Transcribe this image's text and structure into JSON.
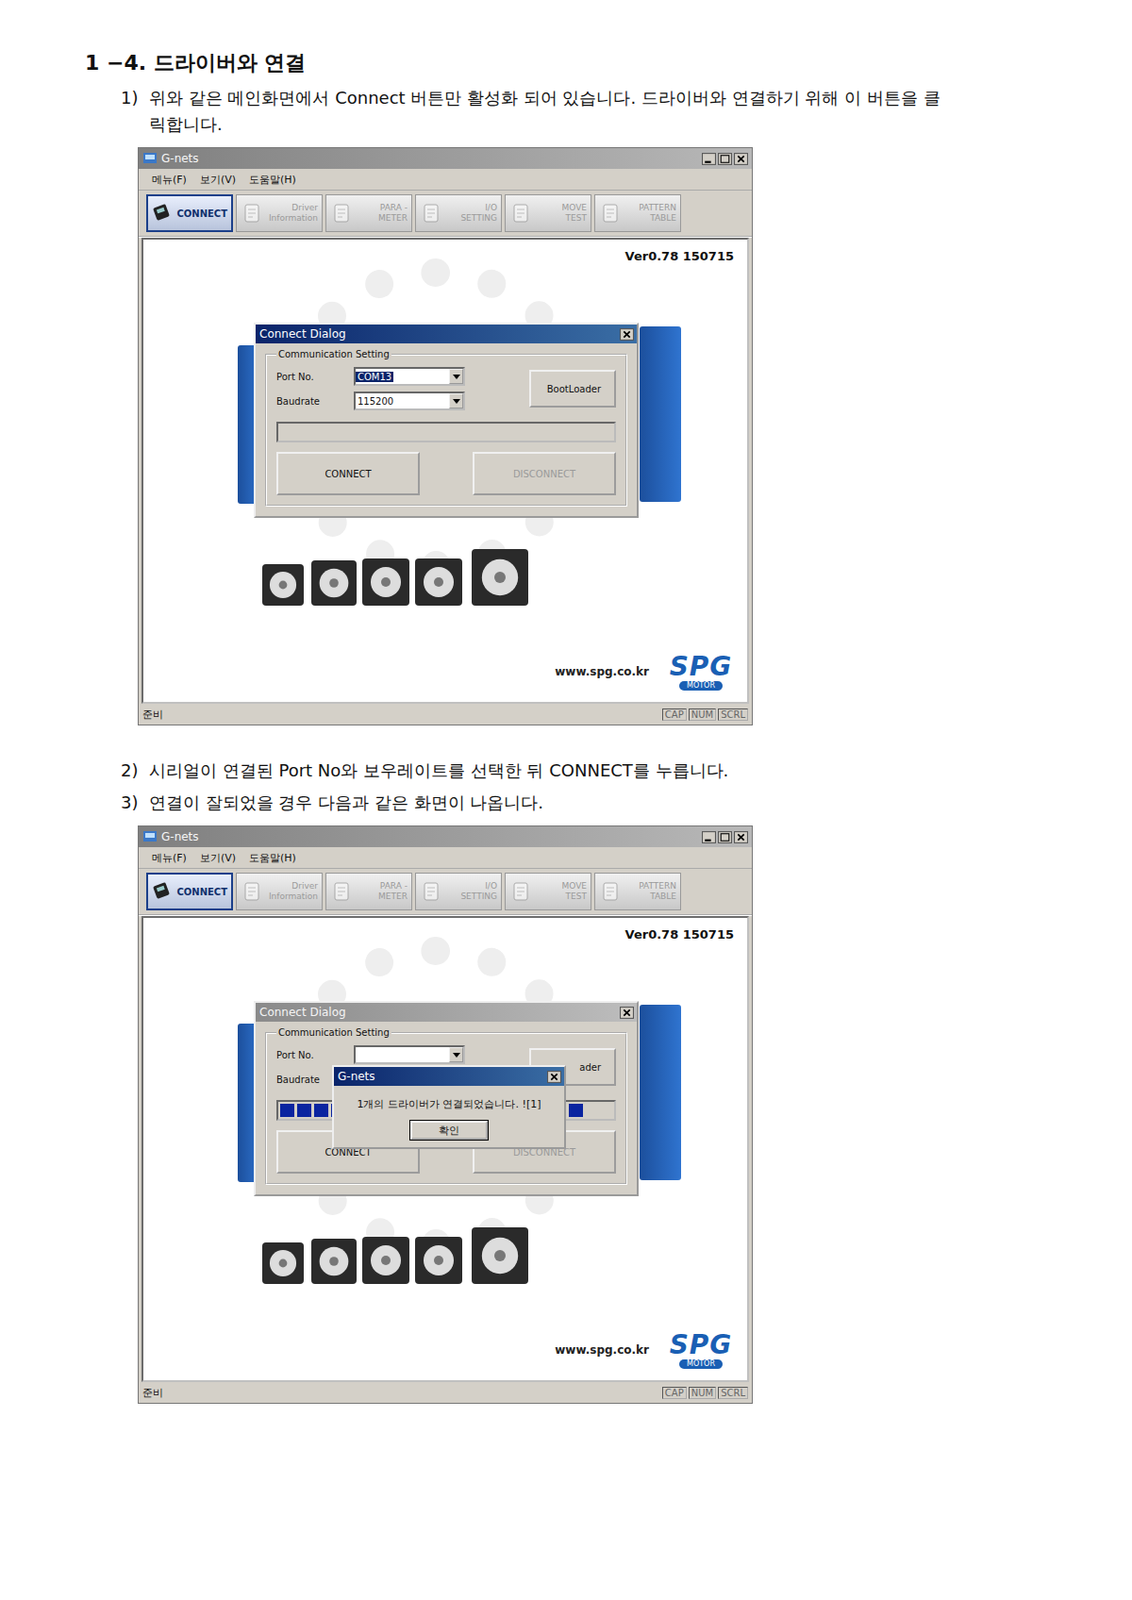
{
  "heading": "1 −4. 드라이버와 연결",
  "sections": [
    {
      "steps": [
        {
          "number": "1)",
          "text": "위와 같은 메인화면에서 Connect 버튼만 활성화 되어 있습니다. 드라이버와 연결하기 위해 이 버튼을 클릭합니다."
        }
      ],
      "screenshot": {
        "title": "G-nets",
        "active": false,
        "menu": [
          "메뉴(F)",
          "보기(V)",
          "도움말(H)"
        ],
        "toolbar": [
          {
            "lines": [
              "CONNECT"
            ],
            "selected": true,
            "disabled": false
          },
          {
            "lines": [
              "Driver",
              "Information"
            ],
            "selected": false,
            "disabled": true
          },
          {
            "lines": [
              "PARA -",
              "METER"
            ],
            "selected": false,
            "disabled": true
          },
          {
            "lines": [
              "I/O",
              "SETTING"
            ],
            "selected": false,
            "disabled": true
          },
          {
            "lines": [
              "MOVE",
              "TEST"
            ],
            "selected": false,
            "disabled": true
          },
          {
            "lines": [
              "PATTERN",
              "TABLE"
            ],
            "selected": false,
            "disabled": true
          }
        ],
        "version": "Ver0.78 150715",
        "dialog": {
          "title": "Connect Dialog",
          "active": true,
          "group": "Communication Setting",
          "fields": [
            {
              "label": "Port No.",
              "value": "COM13",
              "selected": true
            },
            {
              "label": "Baudrate",
              "value": "115200",
              "selected": false
            }
          ],
          "bootloader": "BootLoader",
          "progress": 0,
          "connect": {
            "label": "CONNECT",
            "disabled": false
          },
          "disconnect": {
            "label": "DISCONNECT",
            "disabled": true
          }
        },
        "message": null,
        "url": "www.spg.co.kr",
        "logo": "SPG",
        "logo_sub": "MOTOR",
        "status": "준비",
        "indicators": [
          "CAP",
          "NUM",
          "SCRL"
        ]
      }
    },
    {
      "steps": [
        {
          "number": "2)",
          "text": "시리얼이 연결된 Port No와 보우레이트를 선택한 뒤 CONNECT를 누릅니다."
        },
        {
          "number": "3)",
          "text": "연결이 잘되었을 경우 다음과 같은 화면이 나옵니다."
        }
      ],
      "screenshot": {
        "title": "G-nets",
        "active": false,
        "menu": [
          "메뉴(F)",
          "보기(V)",
          "도움말(H)"
        ],
        "toolbar": [
          {
            "lines": [
              "CONNECT"
            ],
            "selected": true,
            "disabled": false
          },
          {
            "lines": [
              "Driver",
              "Information"
            ],
            "selected": false,
            "disabled": true
          },
          {
            "lines": [
              "PARA -",
              "METER"
            ],
            "selected": false,
            "disabled": true
          },
          {
            "lines": [
              "I/O",
              "SETTING"
            ],
            "selected": false,
            "disabled": true
          },
          {
            "lines": [
              "MOVE",
              "TEST"
            ],
            "selected": false,
            "disabled": true
          },
          {
            "lines": [
              "PATTERN",
              "TABLE"
            ],
            "selected": false,
            "disabled": true
          }
        ],
        "version": "Ver0.78 150715",
        "dialog": {
          "title": "Connect Dialog",
          "active": false,
          "group": "Communication Setting",
          "fields": [
            {
              "label": "Port No.",
              "value": "",
              "selected": false
            },
            {
              "label": "Baudrate",
              "value": "",
              "selected": false
            }
          ],
          "bootloader": "ader",
          "progress": 1,
          "connect": {
            "label": "CONNECT",
            "disabled": false
          },
          "disconnect": {
            "label": "DISCONNECT",
            "disabled": true
          }
        },
        "message": {
          "title": "G-nets",
          "text": "1개의 드라이버가 연결되었습니다. ![1]",
          "button": "확인"
        },
        "url": "www.spg.co.kr",
        "logo": "SPG",
        "logo_sub": "MOTOR",
        "status": "준비",
        "indicators": [
          "CAP",
          "NUM",
          "SCRL"
        ]
      }
    }
  ]
}
